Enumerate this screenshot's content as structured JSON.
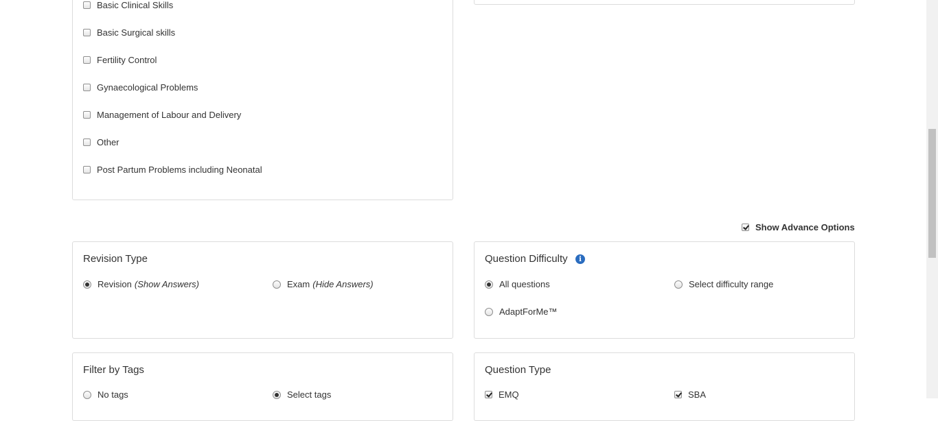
{
  "topics": {
    "items": [
      {
        "label": "Basic Clinical Skills",
        "checked": false
      },
      {
        "label": "Basic Surgical skills",
        "checked": false
      },
      {
        "label": "Fertility Control",
        "checked": false
      },
      {
        "label": "Gynaecological Problems",
        "checked": false
      },
      {
        "label": "Management of Labour and Delivery",
        "checked": false
      },
      {
        "label": "Other",
        "checked": false
      },
      {
        "label": "Post Partum Problems including Neonatal",
        "checked": false
      }
    ]
  },
  "advanced": {
    "label": "Show Advance Options",
    "checked": true
  },
  "revision_type": {
    "title": "Revision Type",
    "options": [
      {
        "label": "Revision",
        "hint": "(Show Answers)",
        "selected": true
      },
      {
        "label": "Exam",
        "hint": "(Hide Answers)",
        "selected": false
      }
    ]
  },
  "question_difficulty": {
    "title": "Question Difficulty",
    "info_icon": "i",
    "options": [
      {
        "label": "All questions",
        "selected": true
      },
      {
        "label": "Select difficulty range",
        "selected": false
      },
      {
        "label": "AdaptForMe™",
        "selected": false
      }
    ]
  },
  "filter_tags": {
    "title": "Filter by Tags",
    "options": [
      {
        "label": "No tags",
        "selected": false
      },
      {
        "label": "Select tags",
        "selected": true
      }
    ]
  },
  "question_type": {
    "title": "Question Type",
    "options": [
      {
        "label": "EMQ",
        "checked": true
      },
      {
        "label": "SBA",
        "checked": true
      }
    ]
  },
  "colors": {
    "border": "#dcdcdc",
    "info": "#2a6cbf",
    "text": "#333333"
  }
}
